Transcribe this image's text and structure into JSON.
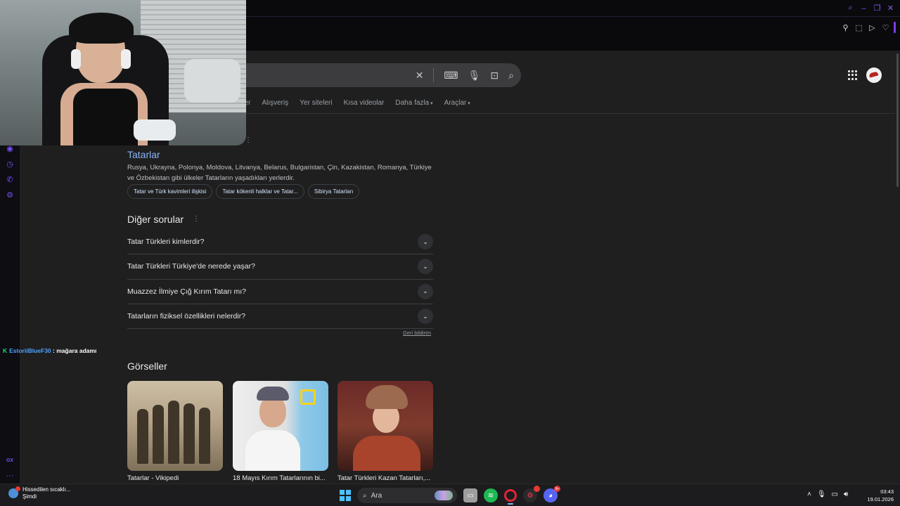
{
  "search": {
    "tabs": [
      "rler",
      "Alışveriş",
      "Yer siteleri",
      "Kısa videolar",
      "Daha fazla",
      "Araçlar"
    ]
  },
  "result": {
    "title": "Tatarlar",
    "snippet": "Rusya, Ukrayna, Polonya, Moldova, Litvanya, Belarus, Bulgaristan, Çin, Kazakistan, Romanya, Türkiye ve Özbekistan gibi ülkeler Tatarların yaşadıkları yerlerdir.",
    "chips": [
      "Tatar ve Türk kavimleri ilişkisi",
      "Tatar kökenli halklar ve Tatar...",
      "Sibirya Tatarları"
    ]
  },
  "people_also_ask": {
    "title": "Diğer sorular",
    "questions": [
      "Tatar Türkleri kimlerdir?",
      "Tatar Türkleri Türkiye'de nerede yaşar?",
      "Muazzez İlmiye Çığ Kırım Tatarı mı?",
      "Tatarların fiziksel özellikleri nelerdir?"
    ],
    "feedback": "Geri bildirim"
  },
  "images": {
    "title": "Görseller",
    "items": [
      {
        "caption": "Tatarlar - Vikipedi"
      },
      {
        "caption": "18 Mayıs Kırım Tatarlarının bi..."
      },
      {
        "caption": "Tatar Türkleri Kazan Tatarları,..."
      }
    ]
  },
  "chat": {
    "user": "EstoriiBlueF30",
    "message": ": mağara adamı"
  },
  "sidebar_bottom": {
    "gx": "GX",
    "more": "···"
  },
  "taskbar": {
    "weather_line1": "Hissedilen sıcaklı...",
    "weather_line2": "Şimdi",
    "search_placeholder": "Ara",
    "discord_badge": "9+",
    "time": "03:43",
    "date": "19.01.2026"
  },
  "colors": {
    "accent": "#8ab4f8",
    "sidebar_accent": "#7c4dff",
    "background": "#1f1f1f"
  }
}
